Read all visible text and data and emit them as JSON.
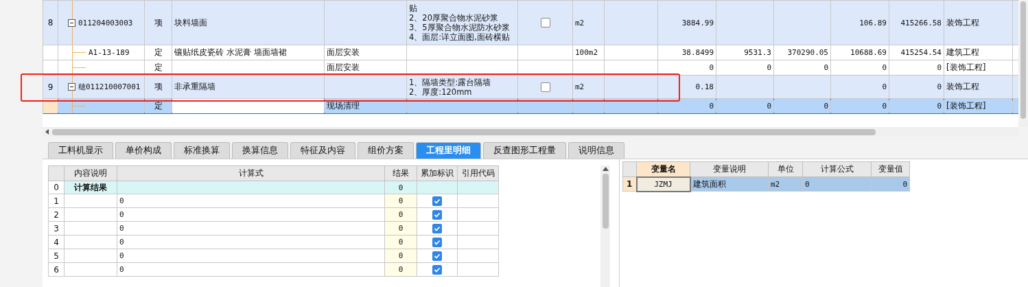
{
  "top_table": {
    "rows": [
      {
        "kind": "item",
        "selected": false,
        "expanded": true,
        "index": "8",
        "code": "011204003003",
        "type": "项",
        "name": "块料墙面",
        "work": "",
        "features": [
          "贴",
          "2、20厚聚合物水泥砂浆",
          "3、5厚聚合物水泥防水砂浆",
          "4、面层:详立面图,面砖横贴"
        ],
        "checked": false,
        "unit": "m2",
        "values": {
          "col_10": "3884.99",
          "col_13": "106.89",
          "col_14": "415266.58"
        },
        "category": "装饰工程"
      },
      {
        "kind": "quota",
        "selected": false,
        "index": "",
        "code": "A1-13-189",
        "type": "定",
        "name": "镶贴纸皮瓷砖 水泥膏 墙面墙裙",
        "work": "面层安装",
        "features": [],
        "unit": "100m2",
        "values": {
          "col_10": "38.8499",
          "col_11": "9531.3",
          "col_12": "370290.05",
          "col_13": "10688.69",
          "col_14": "415254.54"
        },
        "category": "建筑工程"
      },
      {
        "kind": "quota",
        "selected": false,
        "index": "",
        "code": "",
        "type": "定",
        "name": "",
        "work": "面层安装",
        "features": [],
        "unit": "",
        "values": {
          "col_10": "0",
          "col_11": "0",
          "col_12": "0",
          "col_13": "0",
          "col_14": "0"
        },
        "category": "[装饰工程]"
      },
      {
        "kind": "item",
        "selected": false,
        "expanded": true,
        "index": "9",
        "code": "穂011210007001",
        "type": "项",
        "name": "非承重隔墙",
        "work": "",
        "features": [
          "1、隔墙类型:露台隔墙",
          "2、厚度:120mm"
        ],
        "checked": false,
        "unit": "m2",
        "values": {
          "col_10": "0.18",
          "col_13": "0",
          "col_14": "0"
        },
        "category": "装饰工程"
      },
      {
        "kind": "quota",
        "selected": true,
        "index": "",
        "code": "",
        "type": "定",
        "name": "",
        "work": "现场清理",
        "features": [],
        "unit": "",
        "values": {
          "col_10": "0",
          "col_11": "0",
          "col_12": "0",
          "col_13": "0",
          "col_14": "0"
        },
        "category": "[装饰工程]"
      }
    ]
  },
  "tabs": [
    {
      "label": "工料机显示",
      "selected": false
    },
    {
      "label": "单价构成",
      "selected": false
    },
    {
      "label": "标准换算",
      "selected": false
    },
    {
      "label": "换算信息",
      "selected": false
    },
    {
      "label": "特征及内容",
      "selected": false
    },
    {
      "label": "组价方案",
      "selected": false
    },
    {
      "label": "工程里明细",
      "selected": true
    },
    {
      "label": "反查图形工程量",
      "selected": false
    },
    {
      "label": "说明信息",
      "selected": false
    }
  ],
  "detail_table": {
    "columns": [
      "内容说明",
      "计算式",
      "结果",
      "累加标识",
      "引用代码"
    ],
    "rows": [
      {
        "kind": "total",
        "index": "0",
        "description": "计算结果",
        "formula": "",
        "result": "0"
      },
      {
        "kind": "line",
        "index": "1",
        "description": "",
        "formula": "0",
        "result": "0",
        "checked": true
      },
      {
        "kind": "line",
        "index": "2",
        "description": "",
        "formula": "0",
        "result": "0",
        "checked": true
      },
      {
        "kind": "line",
        "index": "3",
        "description": "",
        "formula": "0",
        "result": "0",
        "checked": true
      },
      {
        "kind": "line",
        "index": "4",
        "description": "",
        "formula": "0",
        "result": "0",
        "checked": true
      },
      {
        "kind": "line",
        "index": "5",
        "description": "",
        "formula": "0",
        "result": "0",
        "checked": true
      },
      {
        "kind": "line",
        "index": "6",
        "description": "",
        "formula": "0",
        "result": "0",
        "checked": true
      }
    ]
  },
  "variable_table": {
    "columns": [
      "变量名",
      "变量说明",
      "单位",
      "计算公式",
      "变量值"
    ],
    "rows": [
      {
        "index": "1",
        "name": "JZMJ",
        "description": "建筑面积",
        "unit": "m2",
        "formula": "0",
        "value": "0",
        "selected": true
      }
    ]
  }
}
